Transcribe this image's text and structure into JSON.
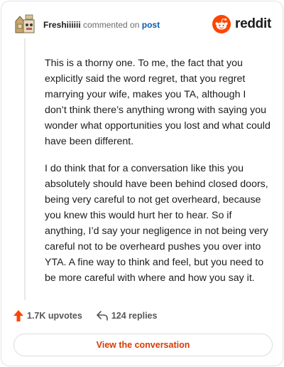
{
  "header": {
    "author": "Freshiiiiii",
    "verb": "commented on",
    "post_link": "post",
    "logo_text": "reddit"
  },
  "comment": {
    "paragraphs": [
      "This is a thorny one. To me, the fact that you explicitly said the word regret, that you regret marrying your wife, makes you TA, although I don’t think there’s anything wrong with saying you wonder what opportunities you lost and what could have been different.",
      "I do think that for a conversation like this you absolutely should have been behind closed doors, being very careful to not get overheard, because you knew this would hurt her to hear. So if anything, I’d say your negligence in not being very careful not to be overheard pushes you over into YTA. A fine way to think and feel, but you need to be more careful with where and how you say it."
    ]
  },
  "actions": {
    "upvotes": "1.7K upvotes",
    "replies": "124 replies"
  },
  "view_button": "View the conversation",
  "colors": {
    "accent": "#ff4500",
    "link": "#0a5cad",
    "button_text": "#d93900"
  },
  "icons": {
    "upvote": "upvote-arrow-icon",
    "reply": "reply-arrow-icon",
    "logo": "reddit-snoo-icon"
  }
}
